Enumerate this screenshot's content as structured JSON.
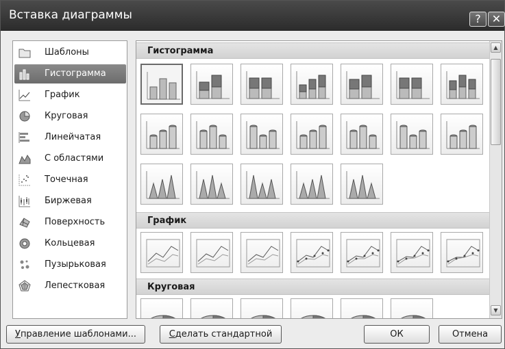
{
  "window": {
    "title": "Вставка диаграммы",
    "help_label": "?",
    "close_label": "✕"
  },
  "sidebar": {
    "items": [
      {
        "label": "Шаблоны",
        "icon": "folder-icon"
      },
      {
        "label": "Гистограмма",
        "icon": "column-chart-icon",
        "selected": true
      },
      {
        "label": "График",
        "icon": "line-chart-icon"
      },
      {
        "label": "Круговая",
        "icon": "pie-chart-icon"
      },
      {
        "label": "Линейчатая",
        "icon": "bar-chart-icon"
      },
      {
        "label": "С областями",
        "icon": "area-chart-icon"
      },
      {
        "label": "Точечная",
        "icon": "scatter-chart-icon"
      },
      {
        "label": "Биржевая",
        "icon": "stock-chart-icon"
      },
      {
        "label": "Поверхность",
        "icon": "surface-chart-icon"
      },
      {
        "label": "Кольцевая",
        "icon": "doughnut-chart-icon"
      },
      {
        "label": "Пузырьковая",
        "icon": "bubble-chart-icon"
      },
      {
        "label": "Лепестковая",
        "icon": "radar-chart-icon"
      }
    ]
  },
  "gallery": {
    "sections": [
      {
        "label": "Гистограмма",
        "tile_count": 19
      },
      {
        "label": "График",
        "tile_count": 7
      },
      {
        "label": "Круговая",
        "tile_count": 6
      }
    ]
  },
  "buttons": {
    "manage_templates": {
      "mnemonic": "У",
      "rest": "правление шаблонами..."
    },
    "set_default": {
      "mnemonic": "С",
      "rest": "делать стандартной"
    },
    "ok": "ОК",
    "cancel": "Отмена"
  }
}
